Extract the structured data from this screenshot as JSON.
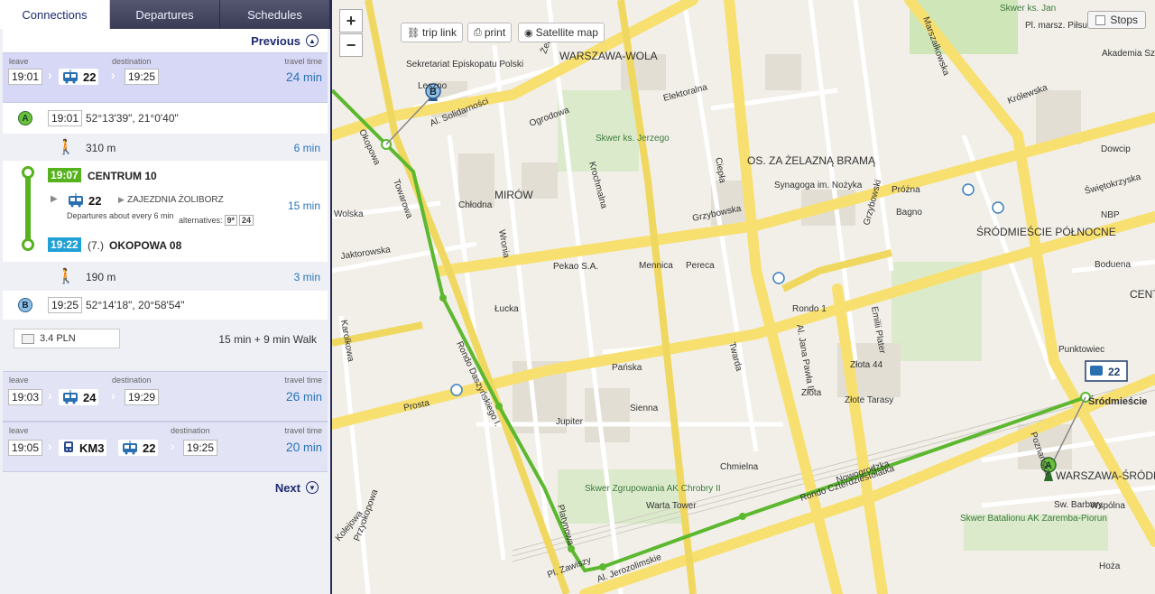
{
  "tabs": [
    {
      "label": "Connections"
    },
    {
      "label": "Departures"
    },
    {
      "label": "Schedules"
    }
  ],
  "pager": {
    "previous": "Previous",
    "next": "Next"
  },
  "labels": {
    "leave": "leave",
    "destination": "destination",
    "travel_time": "travel time",
    "min": "min"
  },
  "connections": [
    {
      "leave": "19:01",
      "line": "22",
      "destination": "19:25",
      "travel": "24"
    },
    {
      "leave": "19:03",
      "line": "24",
      "destination": "19:29",
      "travel": "26"
    },
    {
      "leave": "19:05",
      "line_metro": "KM3",
      "line": "22",
      "destination": "19:25",
      "travel": "20"
    }
  ],
  "detail": {
    "start": {
      "pin": "A",
      "time": "19:01",
      "coords": "52°13'39\", 21°0'40\""
    },
    "walk1": {
      "distance": "310 m",
      "minutes": "6 min"
    },
    "board": {
      "time": "19:07",
      "stop": "CENTRUM 10"
    },
    "ride": {
      "line": "22",
      "direction": "ZAJEZDNIA ŻOLIBORZ",
      "frequency": "Departures about every 6 min",
      "alt_label": "alternatives:",
      "alt1": "9*",
      "alt2": "24",
      "minutes": "15 min"
    },
    "alight": {
      "time": "19:22",
      "prefix": "(7.)",
      "stop": "OKOPOWA 08"
    },
    "walk2": {
      "distance": "190 m",
      "minutes": "3 min"
    },
    "end": {
      "pin": "B",
      "time": "19:25",
      "coords": "52°14'18\", 20°58'54\""
    },
    "price": "3.4 PLN",
    "summary": "15 min + 9 min Walk"
  },
  "map": {
    "buttons": {
      "trip_link": "trip link",
      "print": "print",
      "satellite": "Satellite map",
      "stops": "Stops",
      "zoom_in": "+",
      "zoom_out": "−"
    },
    "districts": [
      "WARSZAWA-WOLA",
      "MIRÓW",
      "OS. ZA ŻELAZNĄ BRAMĄ",
      "ŚRÓDMIEŚCIE PÓŁNOCNE",
      "WARSZAWA-ŚRÓDM",
      "CENT"
    ],
    "streets": [
      "Okopowa",
      "Al. Solidarności",
      "Towarowa",
      "Rondo Daszyńskiego I.",
      "Prosta",
      "Grzybowska",
      "Chłodna",
      "Żelazna",
      "Al. Jana Pawła II",
      "Świętokrzyska",
      "Marszałkowska",
      "Rondo Czterdziestolatka",
      "Al. Jerozolimskie",
      "Złota",
      "Twarda",
      "Emilii Plater",
      "Sienna",
      "Pańska",
      "Krochmalna",
      "Leszno",
      "Elektoralna",
      "Chmielna",
      "Nowogrodzka",
      "Śródmieście",
      "Wolska",
      "Kolejowa",
      "Karolkowa",
      "Przyokopowa",
      "Jaktorowska",
      "Ogrodowa",
      "Wronia",
      "Ciepła",
      "Królewska",
      "Bagno",
      "Próżna",
      "Złote Tarasy",
      "Jupiter",
      "Warta Tower",
      "Rondo 1",
      "Pekao S.A.",
      "Mennica",
      "Skwer ks. Jerzego",
      "Synagoga im. Nożyka",
      "Skwer Zgrupowania AK Chrobry II",
      "Skwer Batalionu AK Zaremba-Piorun",
      "Sekretariat Episkopatu Polski",
      "Akademia Sz",
      "Pl. marsz. Piłsu",
      "Skwer ks. Jan",
      "Dowcip",
      "NBP",
      "Boduena",
      "Punktowiec",
      "Poznańska",
      "Wspólna",
      "Hoża",
      "Sw. Barbary",
      "Pl. Zawiszy",
      "Platynowa",
      "Pereca",
      "Złota 44",
      "Łucka",
      "Grzybowski"
    ],
    "route_badge": "22",
    "pin_a": "A",
    "pin_b": "B"
  },
  "colors": {
    "route": "#5cb82e",
    "road_major": "#f8e070",
    "road_minor": "#ffffff",
    "park": "#cfe6b8",
    "panel_sel": "#d7d7f6",
    "accent_blue": "#2a74b5"
  }
}
